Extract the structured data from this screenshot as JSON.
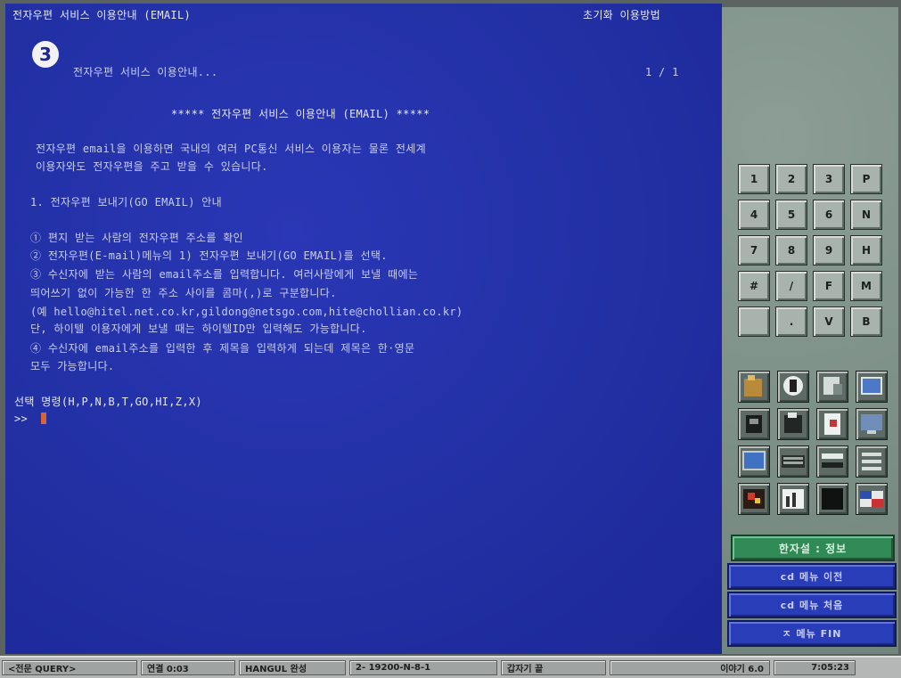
{
  "title_left": "전자우편 서비스 이용안내 (EMAIL)",
  "title_right": "초기화 이용방법",
  "badge": "3",
  "subtitle": "전자우편 서비스 이용안내...",
  "page_indicator": "1 / 1",
  "lines": [
    "***** 전자우편 서비스 이용안내 (EMAIL) *****",
    "전자우편 email을 이용하면 국내의 여러 PC통신 서비스 이용자는 물론 전세계",
    "이용자와도 전자우편을 주고 받을 수 있습니다.",
    "1. 전자우편 보내기(GO EMAIL) 안내",
    "① 편지 받는 사람의 전자우편 주소를 확인",
    "② 전자우편(E-mail)메뉴의 1) 전자우편 보내기(GO EMAIL)를 선택.",
    "③ 수신자에 받는 사람의 email주소를 입력합니다. 여러사람에게 보낼 때에는",
    "   띄어쓰기 없이 가능한 한 주소 사이를 콤마(,)로 구분합니다.",
    "   (예 hello@hitel.net.co.kr,gildong@netsgo.com,hite@chollian.co.kr)",
    "   단, 하이텔 이용자에게 보낼 때는 하이텔ID만 입력해도 가능합니다.",
    "④ 수신자에 email주소를 입력한 후 제목을 입력하게 되는데 제목은 한·영문",
    "   모두 가능합니다."
  ],
  "prompt_line": "선택 명령(H,P,N,B,T,GO,HI,Z,X)",
  "prompt": ">>",
  "keypad": [
    "1",
    "2",
    "3",
    "P",
    "4",
    "5",
    "6",
    "N",
    "7",
    "8",
    "9",
    "H",
    "#",
    "/",
    "F",
    "M",
    "",
    ".",
    "V",
    "B"
  ],
  "icons": [
    "folder-icon",
    "globe-icon",
    "document-icon",
    "window-icon",
    "phone-icon",
    "printer-icon",
    "notepad-icon",
    "monitor-icon",
    "screen-icon",
    "keyboard-icon",
    "toolbar-icon",
    "settings-icon",
    "flag-icon",
    "chart-icon",
    "terminal-icon",
    "flag-alt-icon"
  ],
  "mode_label": "한자설 : 정보",
  "buttons": [
    "cd 메뉴 이전",
    "cd 메뉴 처음",
    "ㅈ 메뉴 FIN"
  ],
  "status": [
    "<전문 QUERY>",
    "연결 0:03",
    "HANGUL 완성",
    "2- 19200-N-8-1",
    "갑자기 끝",
    "이야기 6.0",
    "7:05:23"
  ],
  "colors": {
    "terminal_bg": "#232fa6",
    "panel_bg": "#7f928a",
    "mode_bg": "#2f8a56",
    "button_bg": "#2a3db8",
    "cursor": "#d9643a"
  }
}
